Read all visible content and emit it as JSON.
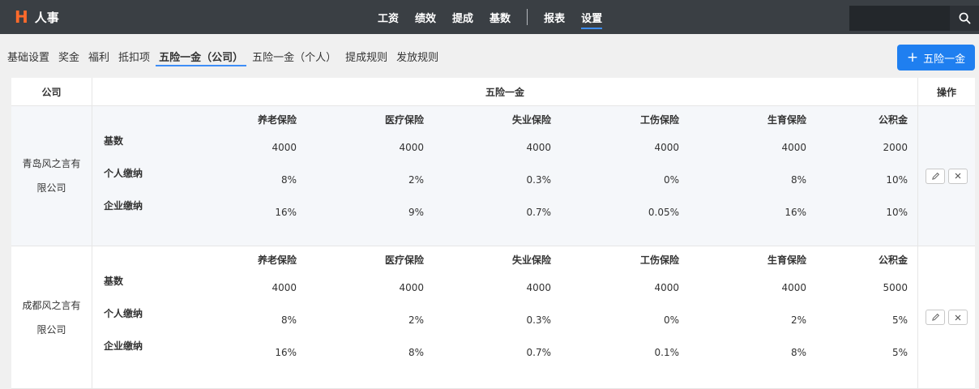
{
  "app": {
    "logo_letter": "H",
    "title": "人事"
  },
  "topnav": {
    "items": [
      "工资",
      "绩效",
      "提成",
      "基数"
    ],
    "items2": [
      "报表",
      "设置"
    ],
    "active": "设置"
  },
  "search": {
    "value": "",
    "placeholder": ""
  },
  "subnav": {
    "tabs": [
      "基础设置",
      "奖金",
      "福利",
      "抵扣项",
      "五险一金（公司）",
      "五险一金（个人）",
      "提成规则",
      "发放规则"
    ],
    "active_index": 4
  },
  "add_button": {
    "icon": "+",
    "label": "五险一金"
  },
  "table": {
    "headers": {
      "company": "公司",
      "main": "五险一金",
      "op": "操作"
    },
    "columns": [
      "养老保险",
      "医疗保险",
      "失业保险",
      "工伤保险",
      "生育保险",
      "公积金"
    ],
    "row_labels": [
      "基数",
      "个人缴纳",
      "企业缴纳"
    ],
    "rows": [
      {
        "company": "青岛风之言有限公司",
        "base": [
          "4000",
          "4000",
          "4000",
          "4000",
          "4000",
          "2000"
        ],
        "personal": [
          "8%",
          "2%",
          "0.3%",
          "0%",
          "8%",
          "10%"
        ],
        "enterprise": [
          "16%",
          "9%",
          "0.7%",
          "0.05%",
          "16%",
          "10%"
        ]
      },
      {
        "company": "成都风之言有限公司",
        "base": [
          "4000",
          "4000",
          "4000",
          "4000",
          "4000",
          "5000"
        ],
        "personal": [
          "8%",
          "2%",
          "0.3%",
          "0%",
          "2%",
          "5%"
        ],
        "enterprise": [
          "16%",
          "8%",
          "0.7%",
          "0.1%",
          "8%",
          "5%"
        ]
      }
    ]
  }
}
